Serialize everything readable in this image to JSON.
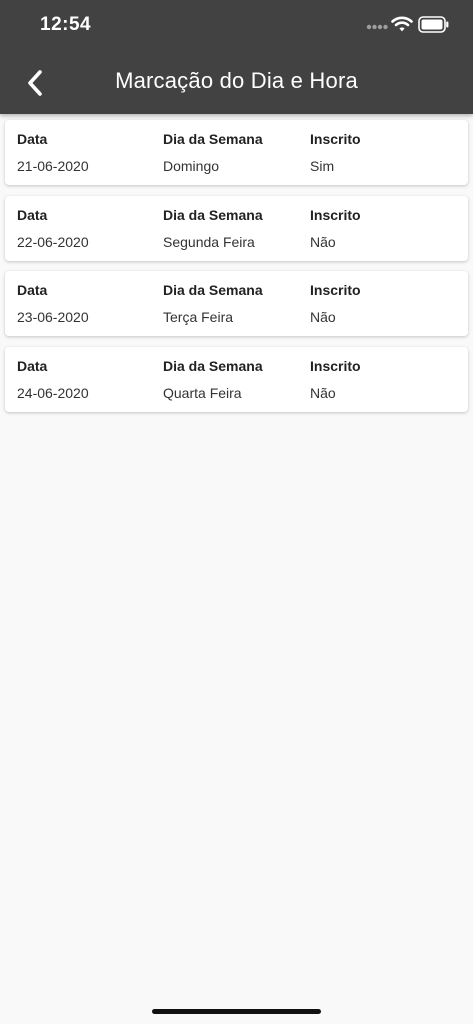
{
  "status_bar": {
    "time": "12:54"
  },
  "header": {
    "title": "Marcação do Dia e Hora"
  },
  "columns": [
    "Data",
    "Dia da Semana",
    "Inscrito"
  ],
  "rows": [
    {
      "date": "21-06-2020",
      "weekday": "Domingo",
      "enrolled": "Sim"
    },
    {
      "date": "22-06-2020",
      "weekday": "Segunda Feira",
      "enrolled": "Não"
    },
    {
      "date": "23-06-2020",
      "weekday": "Terça Feira",
      "enrolled": "Não"
    },
    {
      "date": "24-06-2020",
      "weekday": "Quarta Feira",
      "enrolled": "Não"
    }
  ],
  "colors": {
    "header_bg": "#424242",
    "page_bg": "#f9f9f9",
    "card_bg": "#ffffff"
  },
  "icons": {
    "back": "chevron-left-icon",
    "wifi": "wifi-icon",
    "battery": "battery-icon",
    "signal": "signal-icon"
  }
}
